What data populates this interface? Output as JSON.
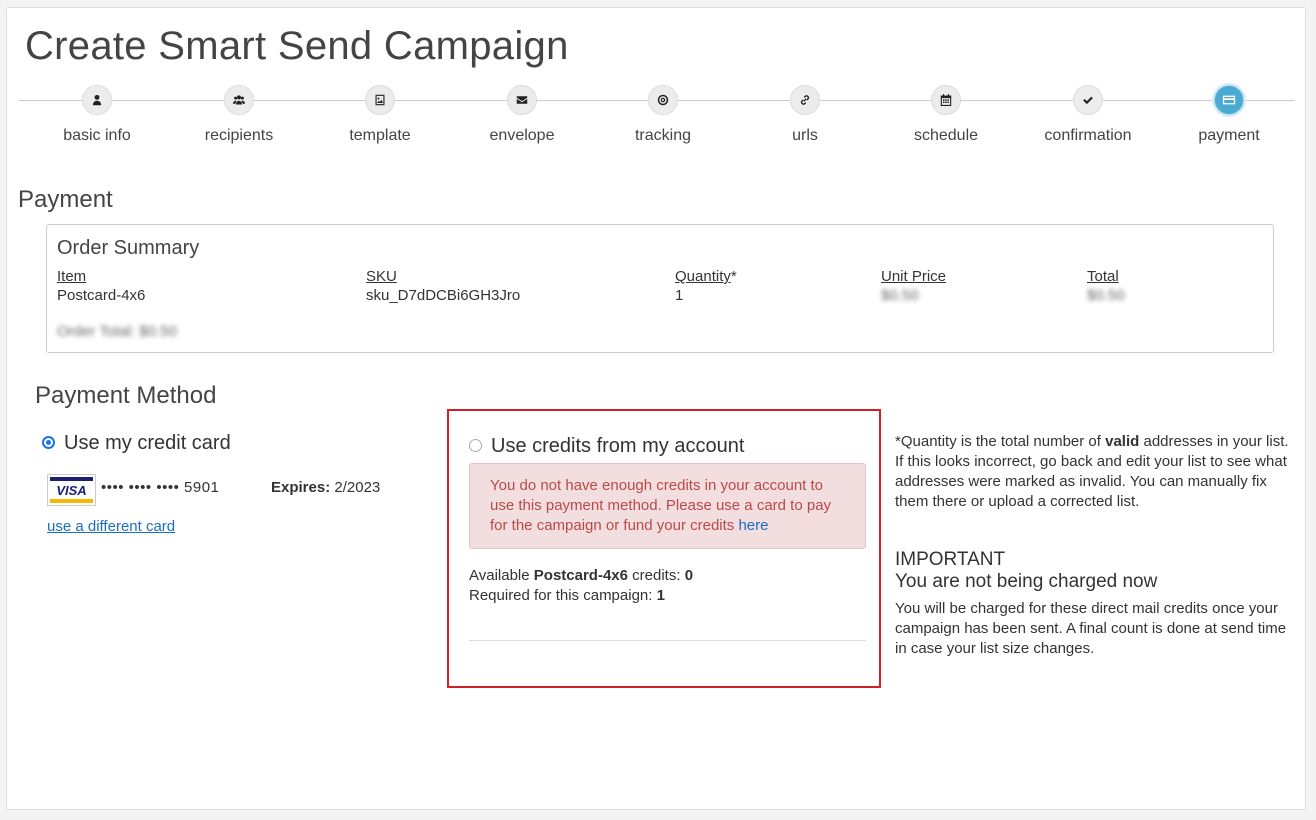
{
  "page_title": "Create Smart Send Campaign",
  "steps": [
    {
      "label": "basic info",
      "icon": "user-icon"
    },
    {
      "label": "recipients",
      "icon": "users-icon"
    },
    {
      "label": "template",
      "icon": "image-icon"
    },
    {
      "label": "envelope",
      "icon": "envelope-icon"
    },
    {
      "label": "tracking",
      "icon": "target-icon"
    },
    {
      "label": "urls",
      "icon": "link-icon"
    },
    {
      "label": "schedule",
      "icon": "calendar-icon"
    },
    {
      "label": "confirmation",
      "icon": "check-icon"
    },
    {
      "label": "payment",
      "icon": "credit-card-icon",
      "active": true
    }
  ],
  "payment": {
    "title": "Payment",
    "order_summary": {
      "title": "Order Summary",
      "headers": {
        "item": "Item",
        "sku": "SKU",
        "quantity": "Quantity",
        "quantity_mark": "*",
        "unit_price": "Unit Price",
        "total": "Total"
      },
      "row": {
        "item": "Postcard-4x6",
        "sku": "sku_D7dDCBi6GH3Jro",
        "quantity": "1",
        "unit_price": "$0.50",
        "total": "$0.50"
      },
      "order_total": "Order Total: $0.50"
    }
  },
  "payment_method": {
    "title": "Payment Method",
    "credit_card": {
      "label": "Use my credit card",
      "selected": true,
      "brand": "VISA",
      "masked_number": "•••• •••• •••• 5901",
      "expires_label": "Expires:",
      "expires_value": "2/2023",
      "different_card_link": "use a different card"
    },
    "credits": {
      "label": "Use credits from my account",
      "selected": false,
      "alert_text": "You do not have enough credits in your account to use this payment method. Please use a card to pay for the campaign or fund your credits ",
      "alert_link": "here",
      "available_prefix": "Available ",
      "available_product": "Postcard-4x6",
      "available_suffix": " credits: ",
      "available_count": "0",
      "required_label": "Required for this campaign: ",
      "required_count": "1"
    }
  },
  "note": {
    "prefix": "*Quantity is the total number of ",
    "bold": "valid",
    "suffix": " addresses in your list. If this looks incorrect, go back and edit your list to see what addresses were marked as invalid. You can manually fix them there or upload a corrected list."
  },
  "important": {
    "heading": "IMPORTANT",
    "subheading": "You are not being charged now",
    "body": "You will be charged for these direct mail credits once your campaign has been sent. A final count is done at send time in case your list size changes."
  },
  "colors": {
    "accent": "#4aaad2",
    "alert_bg": "#f2dede",
    "alert_text": "#b94a48",
    "highlight_border": "#d0202a",
    "link": "#1a6fc4"
  }
}
